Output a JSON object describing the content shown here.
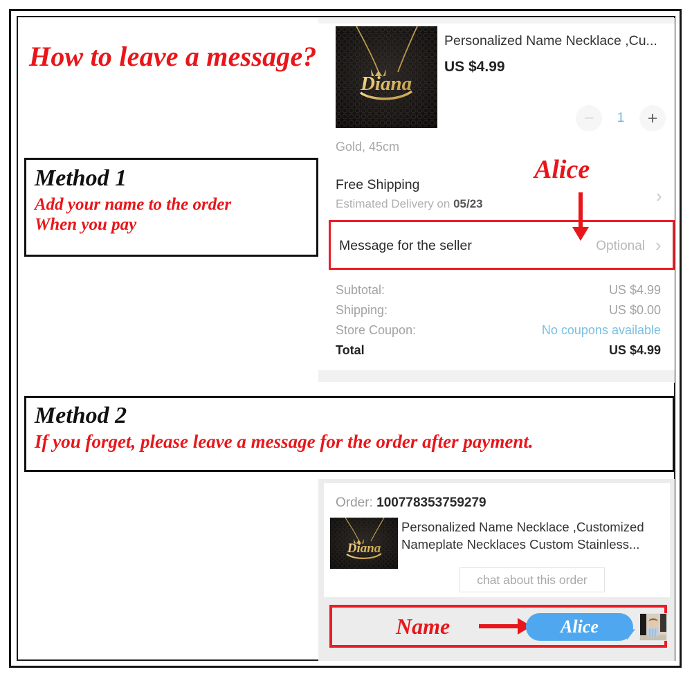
{
  "headline": "How to leave a message?",
  "methods": [
    {
      "title": "Method 1",
      "text": "Add your name to the order\nWhen you pay"
    },
    {
      "title": "Method 2",
      "text": "If you forget, please leave a message for the order after payment."
    }
  ],
  "checkout": {
    "product_title": "Personalized Name Necklace ,Cu...",
    "product_price": "US $4.99",
    "product_thumb_name_text": "Diana",
    "quantity": {
      "minus_label": "−",
      "value": "1",
      "plus_label": "+"
    },
    "variant": "Gold, 45cm",
    "shipping": {
      "title": "Free Shipping",
      "estimate_prefix": "Estimated Delivery on ",
      "estimate_date": "05/23",
      "chevron": "›"
    },
    "message_row": {
      "label": "Message for the seller",
      "value": "Optional",
      "chevron": "›",
      "highlight_color": "#ec1c24"
    },
    "summary": [
      {
        "key": "Subtotal:",
        "value": "US $4.99",
        "style": "normal"
      },
      {
        "key": "Shipping:",
        "value": "US $0.00",
        "style": "normal"
      },
      {
        "key": "Store Coupon:",
        "value": "No coupons available",
        "style": "link"
      },
      {
        "key": "Total",
        "value": "US $4.99",
        "style": "total"
      }
    ]
  },
  "callout_alice": "Alice",
  "order_panel": {
    "order_label": "Order: ",
    "order_number": "100778353759279",
    "product_title": "Personalized Name Necklace ,Customized Nameplate Necklaces Custom Stainless...",
    "product_thumb_name_text": "Diana",
    "chat_button": "chat about this order",
    "chat_strip": {
      "callout": "Name",
      "bubble_text": "Alice",
      "bubble_color": "#4fa8ef",
      "highlight_color": "#ec1c24"
    }
  },
  "colors": {
    "accent_red": "#e8161a",
    "box_border": "#111111",
    "link_blue": "#79c0e0",
    "panel_grey": "#ececec"
  }
}
